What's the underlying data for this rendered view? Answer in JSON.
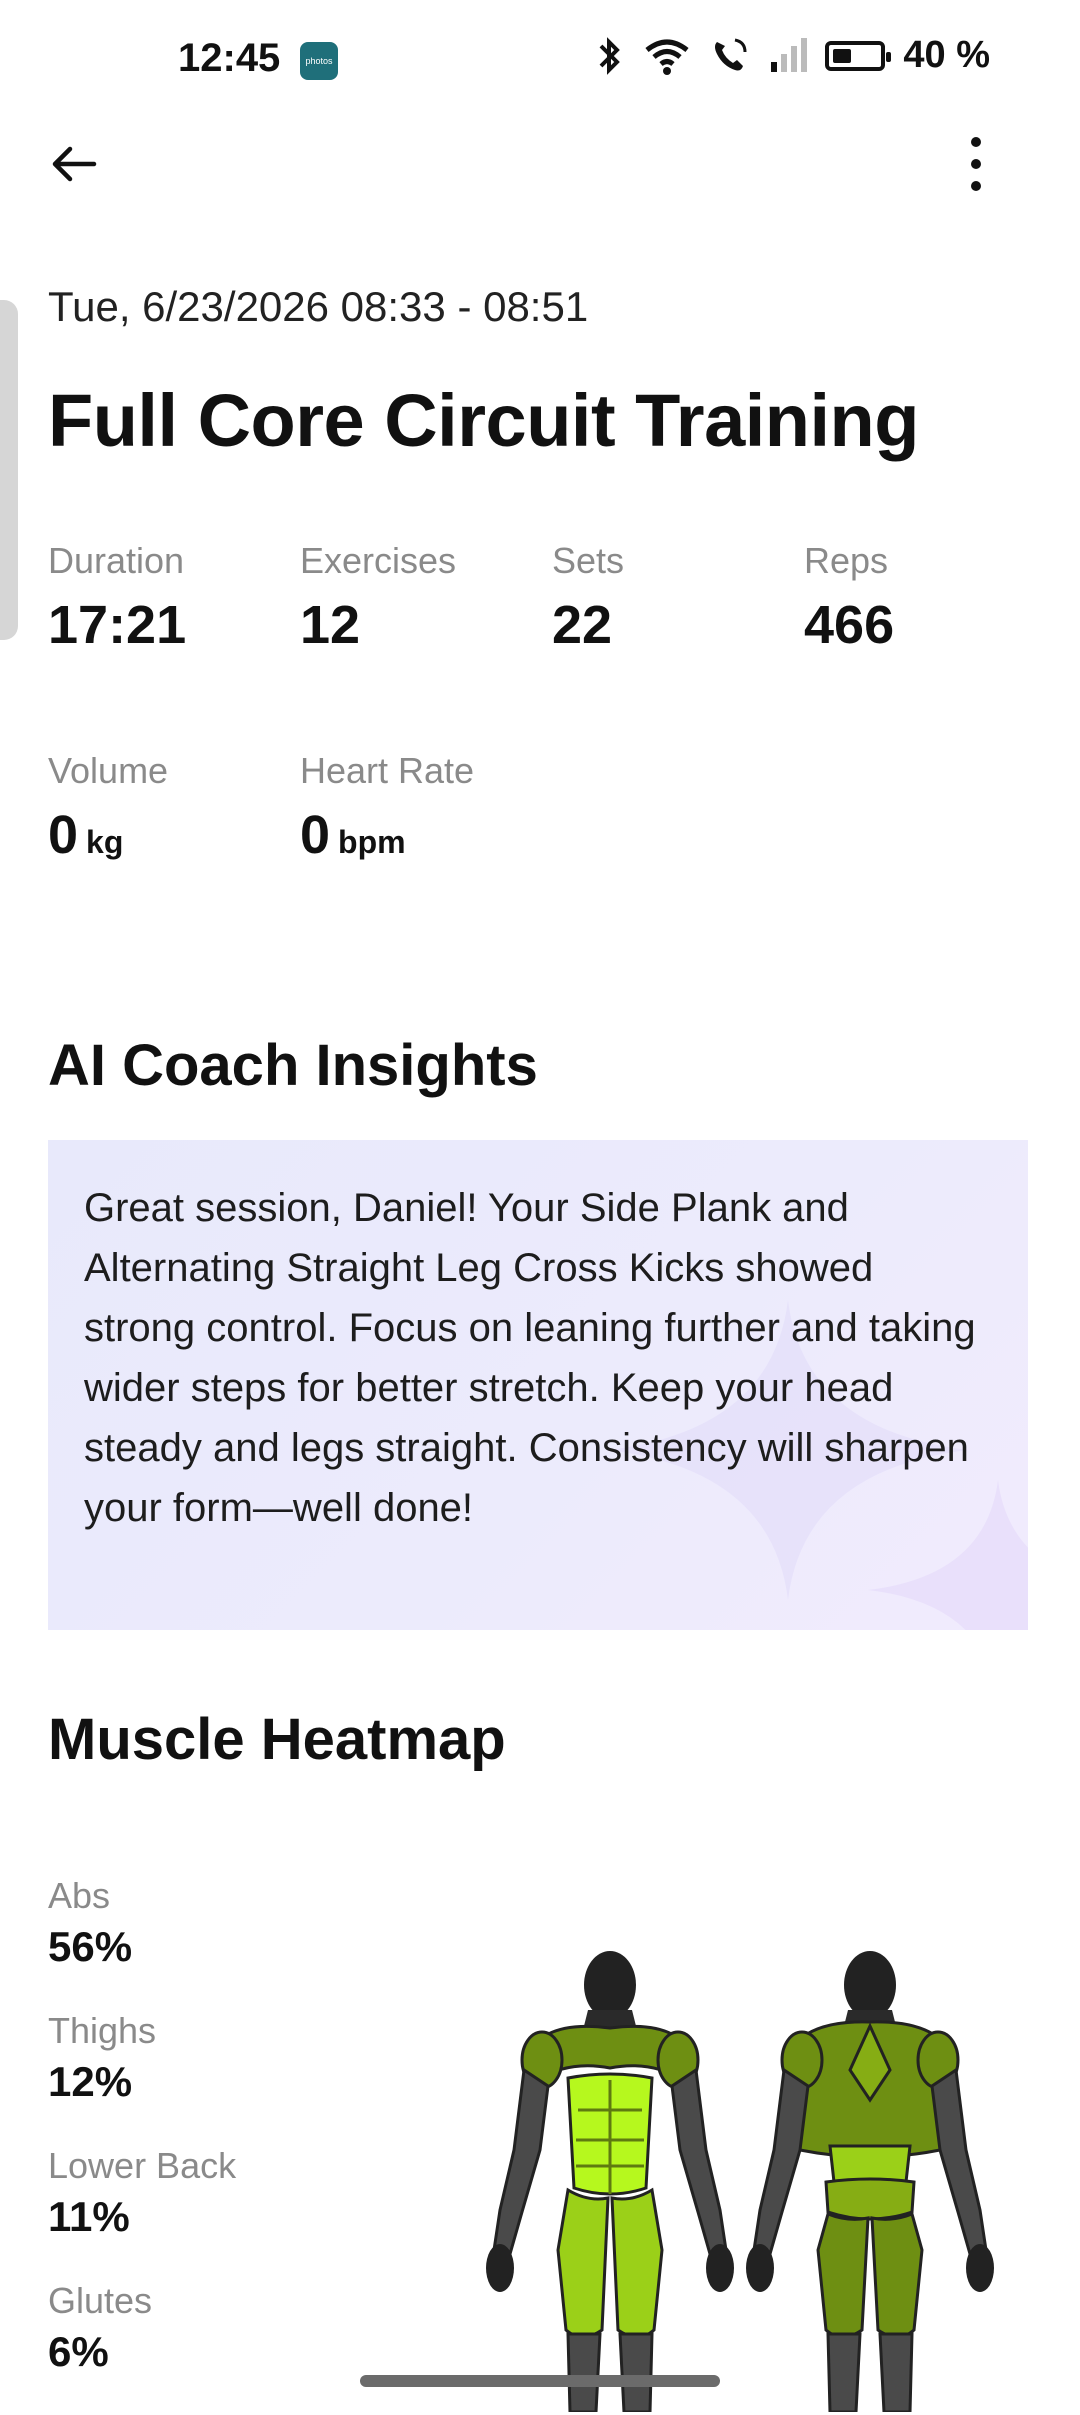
{
  "status_bar": {
    "time": "12:45",
    "photos_badge": "photos",
    "battery": "40 %",
    "battery_level": 0.4
  },
  "header": {
    "datetime": "Tue, 6/23/2026 08:33 - 08:51",
    "title": "Full Core Circuit Training"
  },
  "stats": {
    "duration": {
      "label": "Duration",
      "value": "17:21"
    },
    "exercises": {
      "label": "Exercises",
      "value": "12"
    },
    "sets": {
      "label": "Sets",
      "value": "22"
    },
    "reps": {
      "label": "Reps",
      "value": "466"
    },
    "volume": {
      "label": "Volume",
      "value": "0",
      "unit": "kg"
    },
    "heart_rate": {
      "label": "Heart Rate",
      "value": "0",
      "unit": "bpm"
    }
  },
  "insights": {
    "title": "AI Coach Insights",
    "text": "Great session, Daniel! Your Side Plank and Alternating Straight Leg Cross Kicks showed strong control. Focus on leaning further and taking wider steps for better stretch. Keep your head steady and legs straight. Consistency will sharpen your form—well done!"
  },
  "heatmap": {
    "title": "Muscle Heatmap",
    "muscles": [
      {
        "label": "Abs",
        "value": "56%"
      },
      {
        "label": "Thighs",
        "value": "12%"
      },
      {
        "label": "Lower Back",
        "value": "11%"
      },
      {
        "label": "Glutes",
        "value": "6%"
      }
    ],
    "colors": {
      "high": "#b6f81e",
      "mid": "#6e8f12",
      "low": "#4a4a4a",
      "body": "#222222"
    }
  },
  "icons": {
    "back": "arrow-left-icon",
    "menu": "more-vertical-icon"
  }
}
